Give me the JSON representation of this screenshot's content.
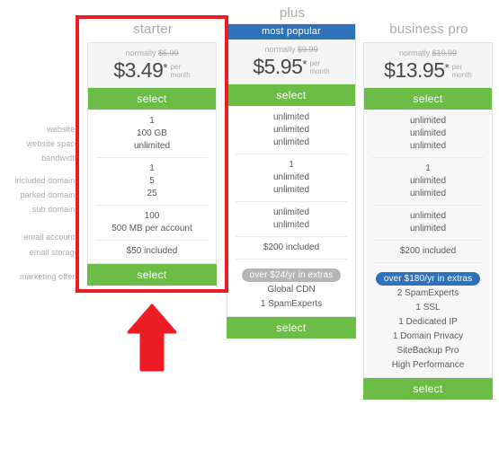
{
  "feature_labels": [
    "websites",
    "website space",
    "bandwidth",
    "included domains",
    "parked domains",
    "sub domains",
    "email accounts",
    "email storage",
    "marketing offers"
  ],
  "colors": {
    "green": "#6cbd45",
    "blue": "#2d72b8",
    "gray_pill": "#b5b5b5",
    "highlight_red": "#ed1c24",
    "text": "#58595b",
    "muted": "#a8aaac"
  },
  "plans": [
    {
      "id": "starter",
      "title": "starter",
      "badge": null,
      "normally_prefix": "normally",
      "normally_price": "$5.99",
      "price": "$3.49",
      "price_star": "*",
      "per": "per",
      "month": "month",
      "select_label": "select",
      "features": [
        "1",
        "100 GB",
        "unlimited",
        "1",
        "5",
        "25",
        "100",
        "500 MB per account",
        "$50 included"
      ],
      "extras_pill": null,
      "extras": [],
      "bottom_select_label": "select",
      "highlighted": true
    },
    {
      "id": "plus",
      "title": "plus",
      "badge": "most popular",
      "normally_prefix": "normally",
      "normally_price": "$9.99",
      "price": "$5.95",
      "price_star": "*",
      "per": "per",
      "month": "month",
      "select_label": "select",
      "features": [
        "unlimited",
        "unlimited",
        "unlimited",
        "1",
        "unlimited",
        "unlimited",
        "unlimited",
        "unlimited",
        "$200 included"
      ],
      "extras_pill": "over $24/yr in extras",
      "extras": [
        "Global CDN",
        "1 SpamExperts"
      ],
      "bottom_select_label": "select",
      "highlighted": false
    },
    {
      "id": "business-pro",
      "title": "business pro",
      "badge": null,
      "normally_prefix": "normally",
      "normally_price": "$19.99",
      "price": "$13.95",
      "price_star": "*",
      "per": "per",
      "month": "month",
      "select_label": "select",
      "features": [
        "unlimited",
        "unlimited",
        "unlimited",
        "1",
        "unlimited",
        "unlimited",
        "unlimited",
        "unlimited",
        "$200 included"
      ],
      "extras_pill": "over $180/yr in extras",
      "extras": [
        "2 SpamExperts",
        "1 SSL",
        "1 Dedicated IP",
        "1 Domain Privacy",
        "SiteBackup Pro",
        "High Performance"
      ],
      "bottom_select_label": "select",
      "highlighted": false
    }
  ],
  "annotation": {
    "highlight_plan": "starter",
    "arrow_direction": "up"
  }
}
